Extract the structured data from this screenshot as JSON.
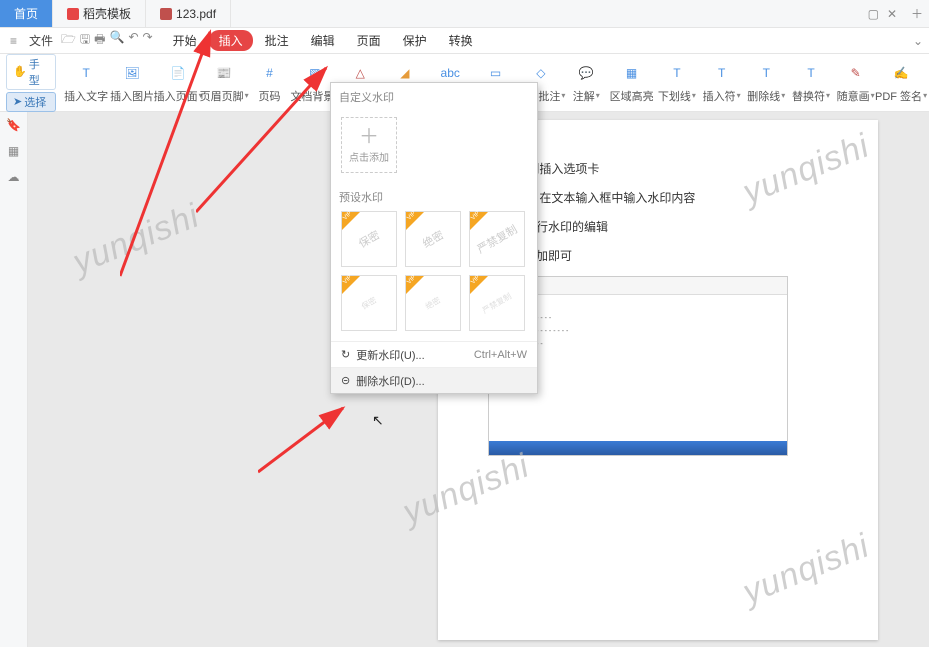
{
  "tabs": {
    "home": "首页",
    "template": "稻壳模板",
    "doc": "123.pdf"
  },
  "menubar": {
    "file": "文件",
    "items": [
      "开始",
      "插入",
      "批注",
      "编辑",
      "页面",
      "保护",
      "转换"
    ],
    "active_index": 1
  },
  "left_small": {
    "hand": "手型",
    "select": "选择"
  },
  "ribbon": [
    {
      "id": "insert-text",
      "label": "插入文字"
    },
    {
      "id": "insert-image",
      "label": "插入图片"
    },
    {
      "id": "insert-page",
      "label": "插入页面",
      "caret": true
    },
    {
      "id": "header-footer",
      "label": "页眉页脚",
      "caret": true
    },
    {
      "id": "page-number",
      "label": "页码"
    },
    {
      "id": "doc-bg",
      "label": "文档背景",
      "caret": true
    },
    {
      "id": "watermark",
      "label": "水印",
      "caret": true
    },
    {
      "id": "highlight",
      "label": "高亮",
      "caret": true
    },
    {
      "id": "text-annot",
      "label": "文字批注"
    },
    {
      "id": "text-box",
      "label": "文本框"
    },
    {
      "id": "shape-annot",
      "label": "形状批注",
      "caret": true
    },
    {
      "id": "notes",
      "label": "注解",
      "caret": true
    },
    {
      "id": "area-hl",
      "label": "区域高亮"
    },
    {
      "id": "strike",
      "label": "下划线",
      "caret": true,
      "text": "T 下划线"
    },
    {
      "id": "insert-sym",
      "label": "插入符",
      "caret": true,
      "text": "T 插入符"
    },
    {
      "id": "strikedel",
      "label": "删除线",
      "caret": true,
      "text": "T 删除线"
    },
    {
      "id": "replace",
      "label": "替换符",
      "caret": true,
      "text": "T 替换符"
    },
    {
      "id": "freehand",
      "label": "随意画",
      "caret": true
    },
    {
      "id": "pdf-sign",
      "label": "PDF 签名",
      "caret": true
    }
  ],
  "panel": {
    "custom_title": "自定义水印",
    "add_label": "点击添加",
    "preset_title": "预设水印",
    "presets": [
      "保密",
      "绝密",
      "严禁复制",
      "保密",
      "绝密",
      "严禁复制"
    ],
    "update": "更新水印(U)...",
    "update_kb": "Ctrl+Alt+W",
    "delete": "删除水印(D)..."
  },
  "doc_lines": [
    "件   切换到插入选项卡",
    "点击添加   在文本输入框中输入水印内容",
    "比页面进行水印的编辑",
    "后确认添加即可"
  ],
  "bg_watermark": "yunqishi"
}
